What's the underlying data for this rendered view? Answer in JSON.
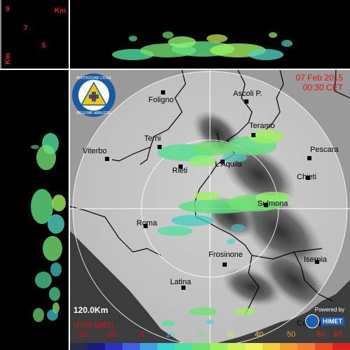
{
  "top_panel": {
    "labels": [
      "9",
      "7",
      "5",
      "Km"
    ]
  },
  "left_panel": {
    "labels": [
      "Km"
    ]
  },
  "header": {
    "date": "07 Feb 2015",
    "time": "00:30 CET"
  },
  "logo": {
    "text": "PROTEZIONE CIVILE REGIONE ABRUZZO"
  },
  "cities": [
    {
      "name": "Foligno"
    },
    {
      "name": "Ascoli P."
    },
    {
      "name": "Teramo"
    },
    {
      "name": "Terni"
    },
    {
      "name": "Viterbo"
    },
    {
      "name": "Pescara"
    },
    {
      "name": "Rieti"
    },
    {
      "name": "L'Aquila"
    },
    {
      "name": "Chieti"
    },
    {
      "name": "Sulmona"
    },
    {
      "name": "Roma"
    },
    {
      "name": "Frosinone"
    },
    {
      "name": "Isernia"
    },
    {
      "name": "Latina"
    },
    {
      "name": "Capua"
    }
  ],
  "range_label": "120.0Km",
  "product_label": "HVMI [dBZ]",
  "powered_by": "Powered by",
  "brand": "HIMET",
  "colorbar": {
    "ticks": [
      "-20",
      "-10",
      "0",
      "10",
      "20",
      "30",
      "40",
      "50",
      "60",
      "65"
    ],
    "colors": [
      "#2a2a4a",
      "#1a1a80",
      "#3030c0",
      "#4060e0",
      "#40a0e0",
      "#40d0d0",
      "#50e0a0",
      "#70e070",
      "#a0f060",
      "#d0f060",
      "#f0f060",
      "#f0d040",
      "#f0a030",
      "#f08030",
      "#e05020",
      "#e02020"
    ]
  }
}
